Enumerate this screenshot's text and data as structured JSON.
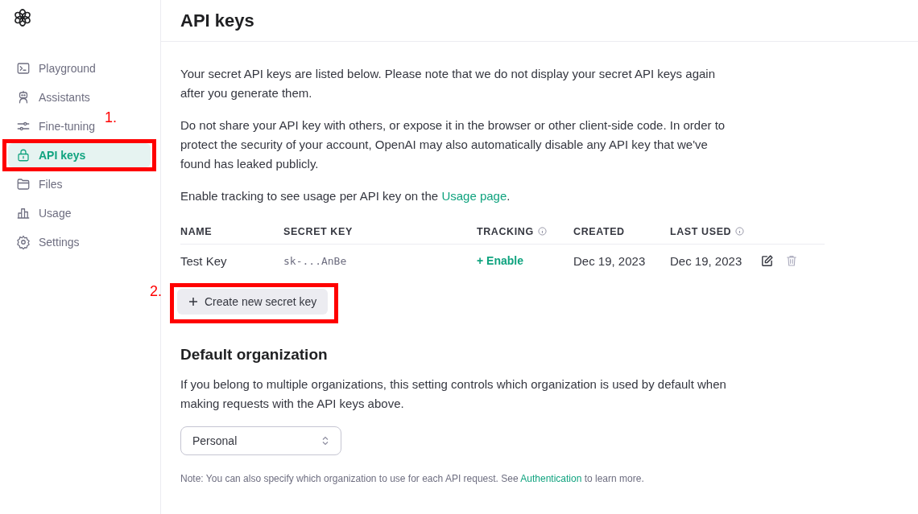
{
  "sidebar": {
    "items": [
      {
        "label": "Playground",
        "kind": "terminal",
        "selected": false
      },
      {
        "label": "Assistants",
        "kind": "robot",
        "selected": false
      },
      {
        "label": "Fine-tuning",
        "kind": "sliders",
        "selected": false,
        "annotation": "1."
      },
      {
        "label": "API keys",
        "kind": "lock",
        "selected": true
      },
      {
        "label": "Files",
        "kind": "folder",
        "selected": false
      },
      {
        "label": "Usage",
        "kind": "chart",
        "selected": false
      },
      {
        "label": "Settings",
        "kind": "gear",
        "selected": false
      }
    ]
  },
  "page_title": "API keys",
  "intro": [
    {
      "text": "Your secret API keys are listed below. Please note that we do not display your secret API keys again after you generate them."
    },
    {
      "text": "Do not share your API key with others, or expose it in the browser or other client-side code. In order to protect the security of your account, OpenAI may also automatically disable any API key that we've found has leaked publicly."
    },
    {
      "text": "Enable tracking to see usage per API key on the ",
      "link": "Usage page",
      "after": "."
    }
  ],
  "table": {
    "columns": [
      {
        "label": "NAME",
        "info": false
      },
      {
        "label": "SECRET KEY",
        "info": false
      },
      {
        "label": "TRACKING",
        "info": true
      },
      {
        "label": "CREATED",
        "info": false
      },
      {
        "label": "LAST USED",
        "info": true
      }
    ],
    "rows": [
      {
        "name": "Test Key",
        "secret_key": "sk-...AnBe",
        "tracking": "+ Enable",
        "created": "Dec 19, 2023",
        "last_used": "Dec 19, 2023"
      }
    ]
  },
  "create_button": {
    "label": "Create new secret key",
    "annotation": "2."
  },
  "default_org": {
    "title": "Default organization",
    "description": "If you belong to multiple organizations, this setting controls which organization is used by default when making requests with the API keys above.",
    "select_value": "Personal",
    "note": {
      "text": "Note: You can also specify which organization to use for each API request. See ",
      "link": "Authentication",
      "after": " to learn more."
    }
  }
}
